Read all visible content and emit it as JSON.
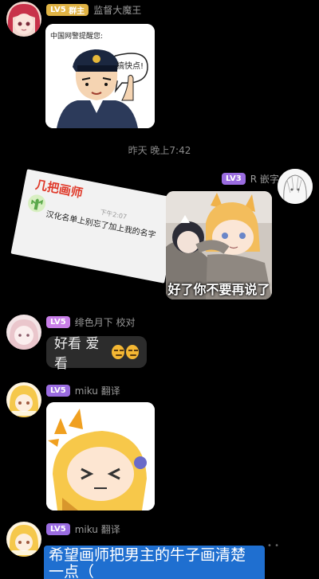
{
  "messages": [
    {
      "user": {
        "level": "LV5",
        "role": "群主",
        "name": "监督大魔王"
      },
      "sticker": {
        "title": "中国网警提醒您:",
        "bubble": "搞快点!"
      }
    },
    {
      "timestamp": "昨天 晚上7:42"
    },
    {
      "user": {
        "level": "LV3",
        "name": "R 嵌字"
      },
      "note": {
        "title": "几把画师",
        "time": "下午2:07",
        "text": "汉化名单上别忘了加上我的名字"
      },
      "sticker": {
        "caption": "好了你不要再说了"
      }
    },
    {
      "user": {
        "level": "LV5",
        "name": "绯色月下 校对"
      },
      "text": "好看 爱看",
      "emojis": [
        "smirk-emoji",
        "smirk-emoji"
      ]
    },
    {
      "user": {
        "level": "LV5",
        "name": "miku 翻译"
      },
      "sticker": {
        "emote": ">_<"
      }
    },
    {
      "user": {
        "level": "LV5",
        "name": "miku 翻译"
      },
      "input_text": "希望画师把男主的牛子画清楚一点（"
    }
  ],
  "colors": {
    "background": "#000000",
    "bubble": "#2c2c2c",
    "input_highlight": "#1f6fd0",
    "badge_gold": "#e0b344",
    "badge_purple": "#9a6ce0"
  }
}
